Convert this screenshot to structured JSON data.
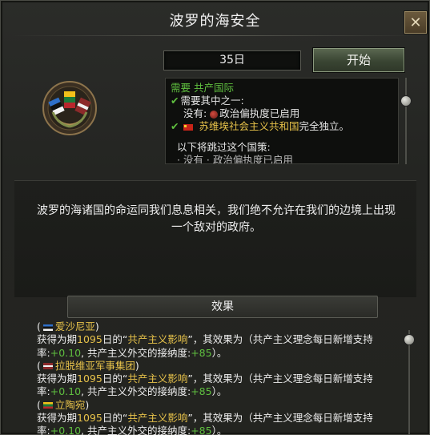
{
  "window": {
    "title": "波罗的海安全",
    "close_label": "✕"
  },
  "decision": {
    "days": "35日",
    "start_label": "开始"
  },
  "requirements": {
    "line1_prefix": "需要",
    "line1_value": "共产国际",
    "line2": "需要其中之一:",
    "line3_prefix": "没有:",
    "line3_value": "政治偏执度已启用",
    "line4_country": "苏维埃社会主义共和国",
    "line4_suffix": "完全独立。",
    "line5": "以下将跳过这个国策:",
    "line6": "· 没有 · 政治偏执度已启用"
  },
  "description": "波罗的海诸国的命运同我们息息相关，我们绝不允许在我们的边境上出现一个敌对的政府。",
  "effects": {
    "header": "效果",
    "items": [
      {
        "country": "爱沙尼亚",
        "flag": "estonia",
        "days": "1095",
        "text_a": "获得为期",
        "text_b": "日的“",
        "modifier": "共产主义影响",
        "text_c": "”，其效果为（共产主义理念每日新增支持率:",
        "value1": "+0.10",
        "text_d": ", 共产主义外交的接纳度:",
        "value2": "+85",
        "text_e": "）。"
      },
      {
        "country": "拉脱维亚军事集团",
        "flag": "latvia",
        "days": "1095",
        "text_a": "获得为期",
        "text_b": "日的“",
        "modifier": "共产主义影响",
        "text_c": "”，其效果为（共产主义理念每日新增支持率:",
        "value1": "+0.10",
        "text_d": ", 共产主义外交的接纳度:",
        "value2": "+85",
        "text_e": "）。"
      },
      {
        "country": "立陶宛",
        "flag": "lithuania",
        "days": "1095",
        "text_a": "获得为期",
        "text_b": "日的“",
        "modifier": "共产主义影响",
        "text_c": "”，其效果为（共产主义理念每日新增支持率:",
        "value1": "+0.10",
        "text_d": ", 共产主义外交的接纳度:",
        "value2": "+85",
        "text_e": "）。"
      }
    ]
  }
}
